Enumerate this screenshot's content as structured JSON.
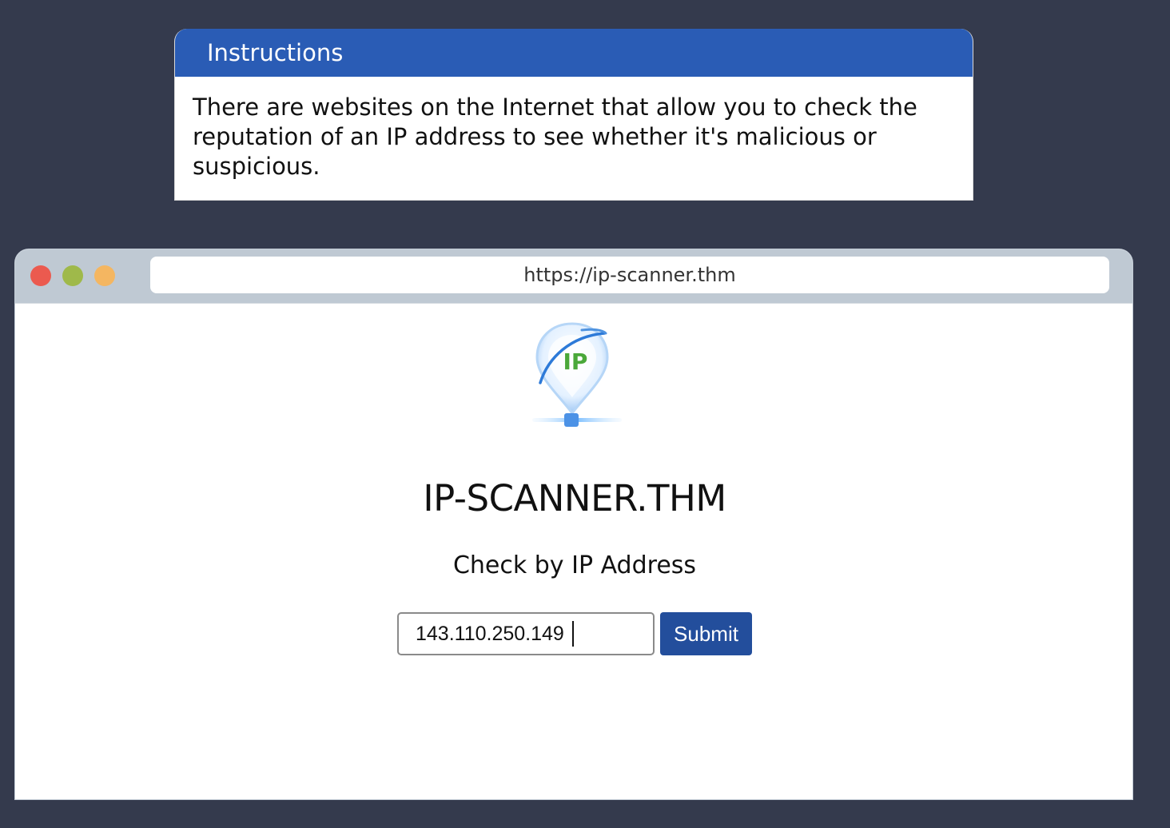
{
  "instructions": {
    "title": "Instructions",
    "body": "There are websites on the Internet that allow you to check the reputation of an IP address to see whether it's malicious or suspicious."
  },
  "browser": {
    "url": "https://ip-scanner.thm",
    "window_controls": [
      "close-dot",
      "minimize-dot",
      "maximize-dot"
    ]
  },
  "site": {
    "logo_text": "IP",
    "title": "IP-SCANNER.THM",
    "subtitle": "Check by IP Address",
    "ip_input_value": "143.110.250.149",
    "submit_label": "Submit"
  },
  "colors": {
    "page_background": "#343a4d",
    "instructions_header": "#2a5cb5",
    "submit_button": "#234e9c",
    "browser_bar": "#bfc9d3"
  }
}
